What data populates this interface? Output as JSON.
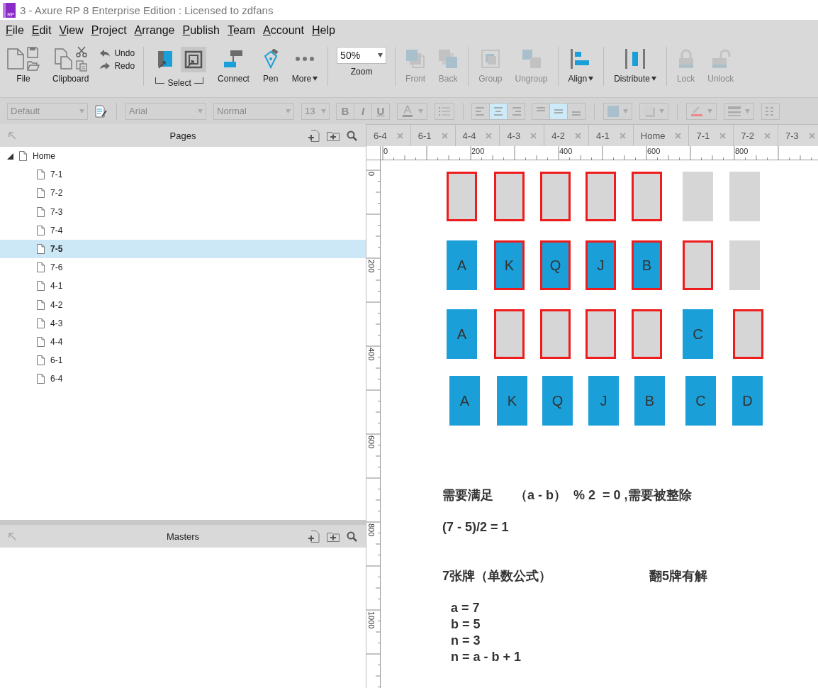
{
  "window": {
    "title": "3 - Axure RP 8 Enterprise Edition : Licensed to zdfans",
    "app_icon_text": "RP"
  },
  "menu": [
    "File",
    "Edit",
    "View",
    "Project",
    "Arrange",
    "Publish",
    "Team",
    "Account",
    "Help"
  ],
  "toolbar": {
    "groups": [
      [
        {
          "kind": "file",
          "label": "File"
        },
        {
          "kind": "clipboard",
          "label": "Clipboard"
        },
        {
          "kind": "history",
          "items": [
            {
              "kind": "undo",
              "label": "Undo"
            },
            {
              "kind": "redo",
              "label": "Redo"
            }
          ]
        }
      ],
      [
        {
          "kind": "select",
          "label": "Select",
          "modes": [
            {
              "selected": false
            },
            {
              "selected": true
            }
          ]
        },
        {
          "kind": "connect",
          "label": "Connect"
        },
        {
          "kind": "pen",
          "label": "Pen"
        },
        {
          "kind": "more",
          "label": "More",
          "dropdown": true
        }
      ],
      [
        {
          "kind": "zoom",
          "value": "50%",
          "label": "Zoom"
        }
      ],
      [
        {
          "kind": "front",
          "label": "Front",
          "disabled": true
        },
        {
          "kind": "back",
          "label": "Back",
          "disabled": true
        }
      ],
      [
        {
          "kind": "group",
          "label": "Group",
          "disabled": true
        },
        {
          "kind": "ungroup",
          "label": "Ungroup",
          "disabled": true
        }
      ],
      [
        {
          "kind": "align",
          "label": "Align",
          "dropdown": true
        }
      ],
      [
        {
          "kind": "distribute",
          "label": "Distribute",
          "dropdown": true
        }
      ],
      [
        {
          "kind": "lock",
          "label": "Lock",
          "disabled": true
        },
        {
          "kind": "unlock",
          "label": "Unlock",
          "disabled": true
        }
      ]
    ]
  },
  "format_bar": {
    "groups": [
      [
        {
          "kind": "select",
          "value": "Default"
        },
        {
          "kind": "style-edit"
        }
      ],
      [
        {
          "kind": "select",
          "value": "Arial"
        },
        {
          "kind": "select",
          "value": "Normal"
        },
        {
          "kind": "size-select",
          "value": "13"
        },
        {
          "kind": "toggles",
          "items": [
            {
              "label": "B"
            },
            {
              "label": "I"
            },
            {
              "label": "U"
            }
          ]
        },
        {
          "kind": "text-color"
        },
        {
          "kind": "bullets"
        }
      ],
      [
        {
          "kind": "segmented",
          "items": [
            {
              "kind": "left",
              "selected": false
            },
            {
              "kind": "center",
              "selected": true
            },
            {
              "kind": "right",
              "selected": false
            }
          ]
        },
        {
          "kind": "segmented",
          "items": [
            {
              "kind": "top",
              "selected": false
            },
            {
              "kind": "middle",
              "selected": true
            },
            {
              "kind": "bottom",
              "selected": false
            }
          ]
        }
      ],
      [
        {
          "kind": "fill"
        },
        {
          "kind": "shadow"
        }
      ],
      [
        {
          "kind": "line-color"
        },
        {
          "kind": "line-style"
        },
        {
          "kind": "line-pattern"
        }
      ]
    ]
  },
  "pages_panel": {
    "title": "Pages",
    "tree": [
      {
        "label": "Home",
        "expanded": true,
        "selected": false,
        "children": [
          {
            "label": "7-1",
            "selected": false
          },
          {
            "label": "7-2",
            "selected": false
          },
          {
            "label": "7-3",
            "selected": false
          },
          {
            "label": "7-4",
            "selected": false
          },
          {
            "label": "7-5",
            "selected": true
          },
          {
            "label": "7-6",
            "selected": false
          },
          {
            "label": "4-1",
            "selected": false
          },
          {
            "label": "4-2",
            "selected": false
          },
          {
            "label": "4-3",
            "selected": false
          },
          {
            "label": "4-4",
            "selected": false
          },
          {
            "label": "6-1",
            "selected": false
          },
          {
            "label": "6-4",
            "selected": false
          }
        ]
      }
    ]
  },
  "masters_panel": {
    "title": "Masters"
  },
  "tabs": [
    {
      "label": "6-4"
    },
    {
      "label": "6-1"
    },
    {
      "label": "4-4"
    },
    {
      "label": "4-3"
    },
    {
      "label": "4-2"
    },
    {
      "label": "4-1"
    },
    {
      "label": "Home"
    },
    {
      "label": "7-1"
    },
    {
      "label": "7-2"
    },
    {
      "label": "7-3"
    }
  ],
  "ruler": {
    "horizontal": [
      "0",
      "200",
      "400",
      "600",
      "800"
    ],
    "vertical": [
      "0",
      "200",
      "400",
      "600",
      "800",
      "1000"
    ]
  },
  "canvas": {
    "card_rows": [
      [
        {
          "face_up": false,
          "outlined": true
        },
        {
          "face_up": false,
          "outlined": true
        },
        {
          "face_up": false,
          "outlined": true
        },
        {
          "face_up": false,
          "outlined": true
        },
        {
          "face_up": false,
          "outlined": true
        },
        {
          "face_up": false,
          "outlined": false
        },
        {
          "face_up": false,
          "outlined": false
        }
      ],
      [
        {
          "face_up": true,
          "label": "A",
          "outlined": false
        },
        {
          "face_up": true,
          "label": "K",
          "outlined": true
        },
        {
          "face_up": true,
          "label": "Q",
          "outlined": true
        },
        {
          "face_up": true,
          "label": "J",
          "outlined": true
        },
        {
          "face_up": true,
          "label": "B",
          "outlined": true
        },
        {
          "face_up": false,
          "outlined": true
        },
        {
          "face_up": false,
          "outlined": false
        }
      ],
      [
        {
          "face_up": true,
          "label": "A",
          "outlined": false
        },
        {
          "face_up": false,
          "outlined": true
        },
        {
          "face_up": false,
          "outlined": true
        },
        {
          "face_up": false,
          "outlined": true
        },
        {
          "face_up": false,
          "outlined": true
        },
        {
          "face_up": true,
          "label": "C",
          "outlined": false
        },
        {
          "face_up": false,
          "outlined": true
        }
      ],
      [
        {
          "face_up": true,
          "label": "A",
          "outlined": false
        },
        {
          "face_up": true,
          "label": "K",
          "outlined": false
        },
        {
          "face_up": true,
          "label": "Q",
          "outlined": false
        },
        {
          "face_up": true,
          "label": "J",
          "outlined": false
        },
        {
          "face_up": true,
          "label": "B",
          "outlined": false
        },
        {
          "face_up": true,
          "label": "C",
          "outlined": false
        },
        {
          "face_up": true,
          "label": "D",
          "outlined": false
        }
      ]
    ],
    "notes": [
      "需要满足      （a - b）  % 2  = 0 ,需要被整除",
      "(7 - 5)/2 = 1",
      "7张牌（单数公式）",
      "翻5牌有解"
    ],
    "formula": [
      "a = 7",
      "b = 5",
      "n = 3",
      "n = a - b + 1"
    ]
  }
}
